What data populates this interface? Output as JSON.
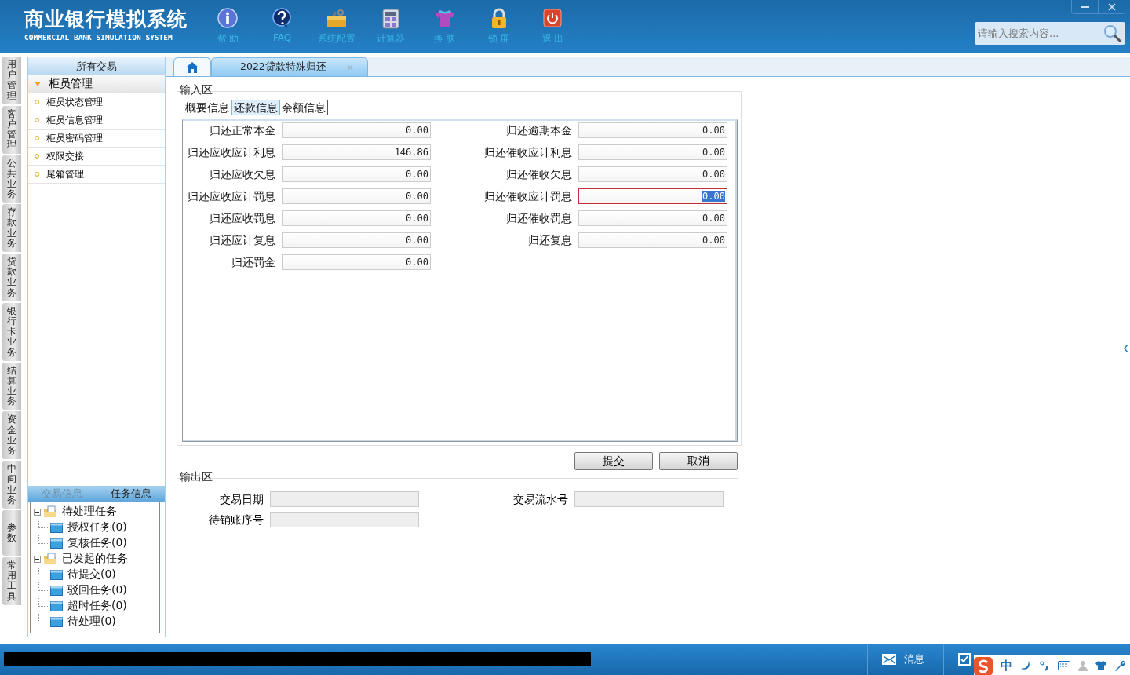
{
  "app": {
    "title": "商业银行模拟系统",
    "subtitle": "COMMERCIAL BANK SIMULATION SYSTEM"
  },
  "toolbar": [
    {
      "label": "帮 助"
    },
    {
      "label": "FAQ"
    },
    {
      "label": "系统配置"
    },
    {
      "label": "计算器"
    },
    {
      "label": "换 肤"
    },
    {
      "label": "锁 屏"
    },
    {
      "label": "退 出"
    }
  ],
  "search": {
    "placeholder": "请输入搜索内容..."
  },
  "module_tabs": [
    {
      "label": "用户管理",
      "selected": false
    },
    {
      "label": "客户管理",
      "selected": false
    },
    {
      "label": "公共业务",
      "selected": false
    },
    {
      "label": "存款业务",
      "selected": false
    },
    {
      "label": "贷款业务",
      "selected": false
    },
    {
      "label": "银行卡业务",
      "selected": false
    },
    {
      "label": "结算业务",
      "selected": false
    },
    {
      "label": "资金业务",
      "selected": false
    },
    {
      "label": "中间业务",
      "selected": false
    },
    {
      "label": "参数",
      "selected": false
    },
    {
      "label": "常用工具",
      "selected": false
    }
  ],
  "sidebar": {
    "header": "所有交易",
    "groups": [
      {
        "label": "柜员管理",
        "expanded": true,
        "items": [
          "柜员状态管理",
          "柜员信息管理",
          "柜员密码管理",
          "权限交接",
          "尾箱管理"
        ]
      }
    ],
    "info_tabs": [
      {
        "label": "交易信息",
        "selected": false
      },
      {
        "label": "任务信息",
        "selected": true
      }
    ],
    "task_tree": [
      {
        "label": "待处理任务",
        "expanded": true,
        "children": [
          {
            "label": "授权任务(0)"
          },
          {
            "label": "复核任务(0)"
          }
        ]
      },
      {
        "label": "已发起的任务",
        "expanded": true,
        "children": [
          {
            "label": "待提交(0)"
          },
          {
            "label": "驳回任务(0)"
          },
          {
            "label": "超时任务(0)"
          },
          {
            "label": "待处理(0)"
          }
        ]
      }
    ]
  },
  "page_tabs": [
    {
      "kind": "home",
      "selected": false
    },
    {
      "kind": "page",
      "label": "2022贷款特殊归还",
      "selected": true
    }
  ],
  "input_area": {
    "title": "输入区",
    "tabs": [
      {
        "label": "概要信息",
        "selected": false
      },
      {
        "label": "还款信息",
        "selected": true
      },
      {
        "label": "余额信息",
        "selected": false
      }
    ],
    "fields": [
      {
        "label": "归还正常本金",
        "value": "0.00",
        "focused": false
      },
      {
        "label": "归还逾期本金",
        "value": "0.00",
        "focused": false
      },
      {
        "label": "归还应收应计利息",
        "value": "146.86",
        "focused": false
      },
      {
        "label": "归还催收应计利息",
        "value": "0.00",
        "focused": false
      },
      {
        "label": "归还应收欠息",
        "value": "0.00",
        "focused": false
      },
      {
        "label": "归还催收欠息",
        "value": "0.00",
        "focused": false
      },
      {
        "label": "归还应收应计罚息",
        "value": "0.00",
        "focused": false
      },
      {
        "label": "归还催收应计罚息",
        "value": "0.00",
        "focused": true
      },
      {
        "label": "归还应收罚息",
        "value": "0.00",
        "focused": false
      },
      {
        "label": "归还催收罚息",
        "value": "0.00",
        "focused": false
      },
      {
        "label": "归还应计复息",
        "value": "0.00",
        "focused": false
      },
      {
        "label": "归还复息",
        "value": "0.00",
        "focused": false
      },
      {
        "label": "归还罚金",
        "value": "0.00",
        "focused": false
      }
    ]
  },
  "buttons": [
    "提交",
    "取消"
  ],
  "output_area": {
    "title": "输出区",
    "fields": [
      {
        "label": "交易日期"
      },
      {
        "label": "交易流水号"
      },
      {
        "label": "待销账序号"
      }
    ]
  },
  "status_bar": {
    "items": [
      {
        "kind": "message",
        "label": "消息"
      },
      {
        "kind": "todo"
      }
    ],
    "ime": {
      "label": "中"
    }
  }
}
